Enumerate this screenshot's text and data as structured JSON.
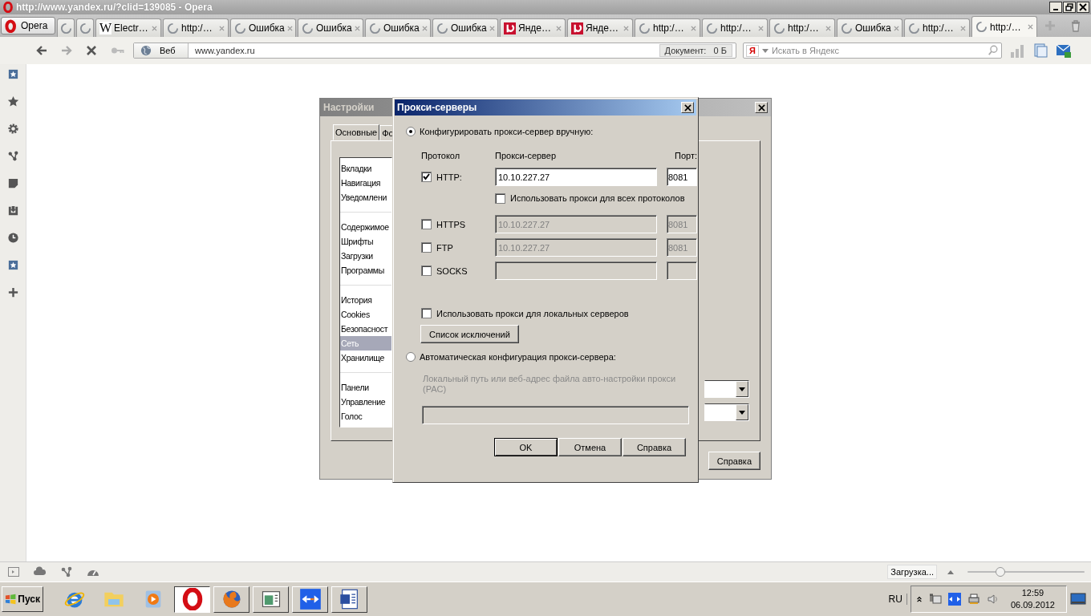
{
  "window": {
    "title": "http://www.yandex.ru/?clid=139085 - Opera"
  },
  "menu_button": {
    "label": "Opera"
  },
  "tabs": [
    {
      "kind": "loading",
      "selected": false
    },
    {
      "kind": "loading",
      "selected": false
    },
    {
      "kind": "glyph",
      "glyph": "W",
      "label": "Electr…",
      "selected": false
    },
    {
      "kind": "loading",
      "label": "http:/…",
      "selected": false
    },
    {
      "kind": "loading",
      "label": "Ошибка",
      "selected": false
    },
    {
      "kind": "loading",
      "label": "Ошибка",
      "selected": false
    },
    {
      "kind": "loading",
      "label": "Ошибка",
      "selected": false
    },
    {
      "kind": "loading",
      "label": "Ошибка",
      "selected": false
    },
    {
      "kind": "favicon",
      "label": "Янде…",
      "selected": false
    },
    {
      "kind": "favicon",
      "label": "Янде…",
      "selected": false
    },
    {
      "kind": "loading",
      "label": "http:/…",
      "selected": false
    },
    {
      "kind": "loading",
      "label": "http:/…",
      "selected": false
    },
    {
      "kind": "loading",
      "label": "http:/…",
      "selected": false
    },
    {
      "kind": "loading",
      "label": "Ошибка",
      "selected": false
    },
    {
      "kind": "loading",
      "label": "http:/…",
      "selected": false
    },
    {
      "kind": "loading",
      "label": "http:/…",
      "selected": true
    }
  ],
  "address_bar": {
    "scope": "Веб",
    "url": "www.yandex.ru",
    "doc_label": "Документ:",
    "doc_size": "0 Б"
  },
  "search": {
    "badge": "Я",
    "placeholder": "Искать в Яндекс"
  },
  "settings": {
    "title": "Настройки",
    "tabs": [
      {
        "label": "Основные",
        "selected": true
      },
      {
        "label": "Фо",
        "selected": false
      }
    ],
    "groups": [
      {
        "items": [
          {
            "label": "Вкладки",
            "selected": false
          },
          {
            "label": "Навигация",
            "selected": false
          },
          {
            "label": "Уведомлени",
            "selected": false
          }
        ]
      },
      {
        "items": [
          {
            "label": "Содержимое",
            "selected": false
          },
          {
            "label": "Шрифты",
            "selected": false
          },
          {
            "label": "Загрузки",
            "selected": false
          },
          {
            "label": "Программы",
            "selected": false
          }
        ]
      },
      {
        "items": [
          {
            "label": "История",
            "selected": false
          },
          {
            "label": "Cookies",
            "selected": false
          },
          {
            "label": "Безопасност",
            "selected": false
          },
          {
            "label": "Сеть",
            "selected": true
          },
          {
            "label": "Хранилище",
            "selected": false
          }
        ]
      },
      {
        "items": [
          {
            "label": "Панели",
            "selected": false
          },
          {
            "label": "Управление",
            "selected": false
          },
          {
            "label": "Голос",
            "selected": false
          }
        ]
      }
    ],
    "help_button": "Справка"
  },
  "proxy": {
    "title": "Прокси-серверы",
    "manual": {
      "label": "Конфигурировать прокси-сервер вручную:",
      "selected": true
    },
    "headers": {
      "protocol": "Протокол",
      "server": "Прокси-сервер",
      "port": "Порт:"
    },
    "rows": [
      {
        "label": "HTTP:",
        "checked": true,
        "disabled": false,
        "server": "10.10.227.27",
        "port": "8081"
      },
      {
        "label": "HTTPS",
        "checked": false,
        "disabled": true,
        "server": "10.10.227.27",
        "port": "8081"
      },
      {
        "label": "FTP",
        "checked": false,
        "disabled": true,
        "server": "10.10.227.27",
        "port": "8081"
      },
      {
        "label": "SOCKS",
        "checked": false,
        "disabled": true
      }
    ],
    "all_protocols": {
      "label": "Использовать прокси для всех протоколов",
      "checked": false
    },
    "local_servers": {
      "label": "Использовать прокси для локальных серверов",
      "checked": false
    },
    "exceptions_button": "Список исключений",
    "auto": {
      "label": "Автоматическая конфигурация прокси-сервера:",
      "selected": false
    },
    "pac_hint": "Локальный путь или веб-адрес файла авто-настройки прокси (PAC)",
    "buttons": [
      {
        "label": "OK",
        "default": true
      },
      {
        "label": "Отмена",
        "default": false
      },
      {
        "label": "Справка",
        "default": false
      }
    ]
  },
  "status_bar": {
    "loading": "Загрузка...",
    "zoom": {
      "level": 0.28
    }
  },
  "taskbar": {
    "start": "Пуск",
    "apps": [
      {
        "kind": "ie",
        "selected": false
      },
      {
        "kind": "folder",
        "selected": false
      },
      {
        "kind": "media",
        "selected": false
      },
      {
        "kind": "opera",
        "selected": true
      },
      {
        "kind": "firefox",
        "selected": false
      },
      {
        "kind": "window",
        "selected": false
      },
      {
        "kind": "arrows",
        "selected": false
      },
      {
        "kind": "word",
        "selected": false
      }
    ],
    "language": "RU",
    "time": "12:59",
    "date": "06.09.2012"
  }
}
